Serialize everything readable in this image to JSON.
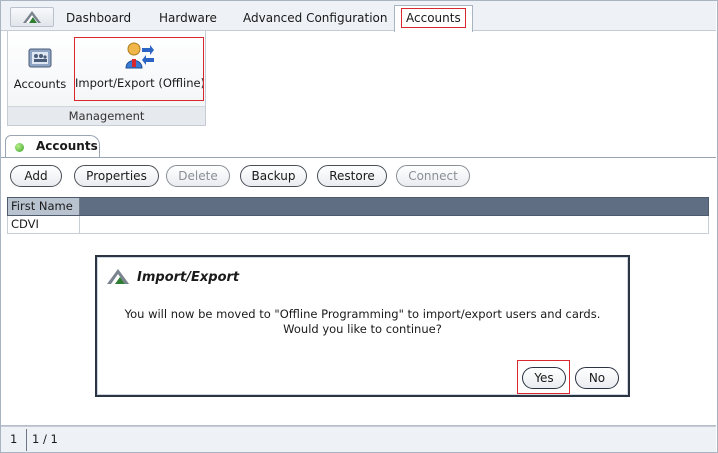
{
  "ribbon_tabs": [
    {
      "label": "Dashboard"
    },
    {
      "label": "Hardware"
    },
    {
      "label": "Advanced Configuration"
    },
    {
      "label": "Accounts",
      "active": true
    }
  ],
  "ribbon": {
    "buttons": [
      {
        "label": "Accounts",
        "icon": "accounts-icon"
      },
      {
        "label": "Import/Export (Offline)",
        "icon": "import-export-icon"
      }
    ],
    "group_label": "Management"
  },
  "document_tab": {
    "label": "Accounts",
    "status_color": "#3aa22a"
  },
  "toolbar": {
    "add": "Add",
    "properties": "Properties",
    "delete": "Delete",
    "backup": "Backup",
    "restore": "Restore",
    "connect": "Connect"
  },
  "grid": {
    "columns": [
      "First Name"
    ],
    "rows": [
      [
        "CDVI"
      ]
    ]
  },
  "dialog": {
    "title": "Import/Export",
    "message_line1": "You will now be moved to \"Offline Programming\" to import/export users and cards.",
    "message_line2": "Would you like to continue?",
    "yes": "Yes",
    "no": "No"
  },
  "status_bar": {
    "page": "1",
    "count": "1 / 1"
  },
  "colors": {
    "highlight": "#d9272e",
    "header_bar": "#5f6e82"
  }
}
